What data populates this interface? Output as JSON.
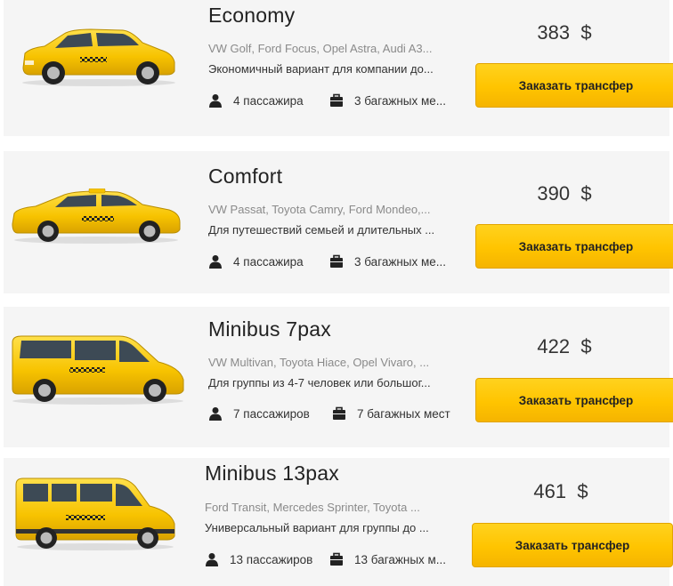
{
  "colors": {
    "accent": "#ffc600",
    "card_bg": "#f5f5f5"
  },
  "cars": [
    {
      "title": "Economy",
      "models": "VW Golf, Ford Focus, Opel Astra, Audi A3...",
      "desc": "Экономичный вариант для компании до...",
      "passengers": "4 пассажира",
      "luggage": "3 багажных ме...",
      "price": "383",
      "currency": "$",
      "button": "Заказать трансфер",
      "image": "hatchback-taxi"
    },
    {
      "title": "Comfort",
      "models": "VW Passat, Toyota Camry, Ford Mondeo,...",
      "desc": "Для путешествий семьей и длительных ...",
      "passengers": "4 пассажира",
      "luggage": "3 багажных ме...",
      "price": "390",
      "currency": "$",
      "button": "Заказать трансфер",
      "image": "sedan-taxi"
    },
    {
      "title": "Minibus 7pax",
      "models": "VW Multivan, Toyota Hiace, Opel Vivaro, ...",
      "desc": "Для группы из 4-7 человек или большог...",
      "passengers": "7 пассажиров",
      "luggage": "7 багажных мест",
      "price": "422",
      "currency": "$",
      "button": "Заказать трансфер",
      "image": "minivan-taxi"
    },
    {
      "title": "Minibus 13pax",
      "models": "Ford Transit, Mercedes Sprinter, Toyota ...",
      "desc": "Универсальный вариант для группы до ...",
      "passengers": "13 пассажиров",
      "luggage": "13 багажных м...",
      "price": "461",
      "currency": "$",
      "button": "Заказать трансфер",
      "image": "minibus-taxi"
    }
  ]
}
